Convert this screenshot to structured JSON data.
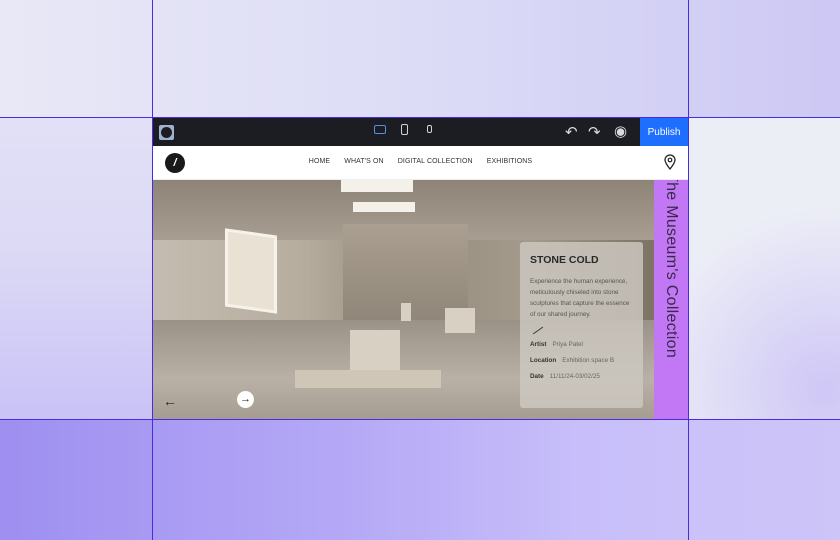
{
  "toolbar": {
    "publish_label": "Publish",
    "icons": [
      "site-logo",
      "desktop-icon",
      "tablet-icon",
      "mobile-icon",
      "undo-icon",
      "redo-icon",
      "preview-eye-icon"
    ]
  },
  "nav": {
    "items": [
      "HOME",
      "WHAT'S ON",
      "DIGITAL COLLECTION",
      "EXHIBITIONS"
    ]
  },
  "hero": {
    "card": {
      "title": "STONE COLD",
      "description": "Experience the human experience, meticulously chiseled into stone sculptures that capture the essence of our shared journey.",
      "artist_label": "Artist",
      "artist": "Priya Patel",
      "location_label": "Location",
      "location": "Exhibition space B",
      "date_label": "Date",
      "date": "11/11/24-03/02/25"
    },
    "side_text": "The Museum's Collection"
  },
  "colors": {
    "accent": "#1e6fff",
    "strip": "#c278f5",
    "toolbar": "#1c1d22",
    "grid": "#4b2be0"
  }
}
